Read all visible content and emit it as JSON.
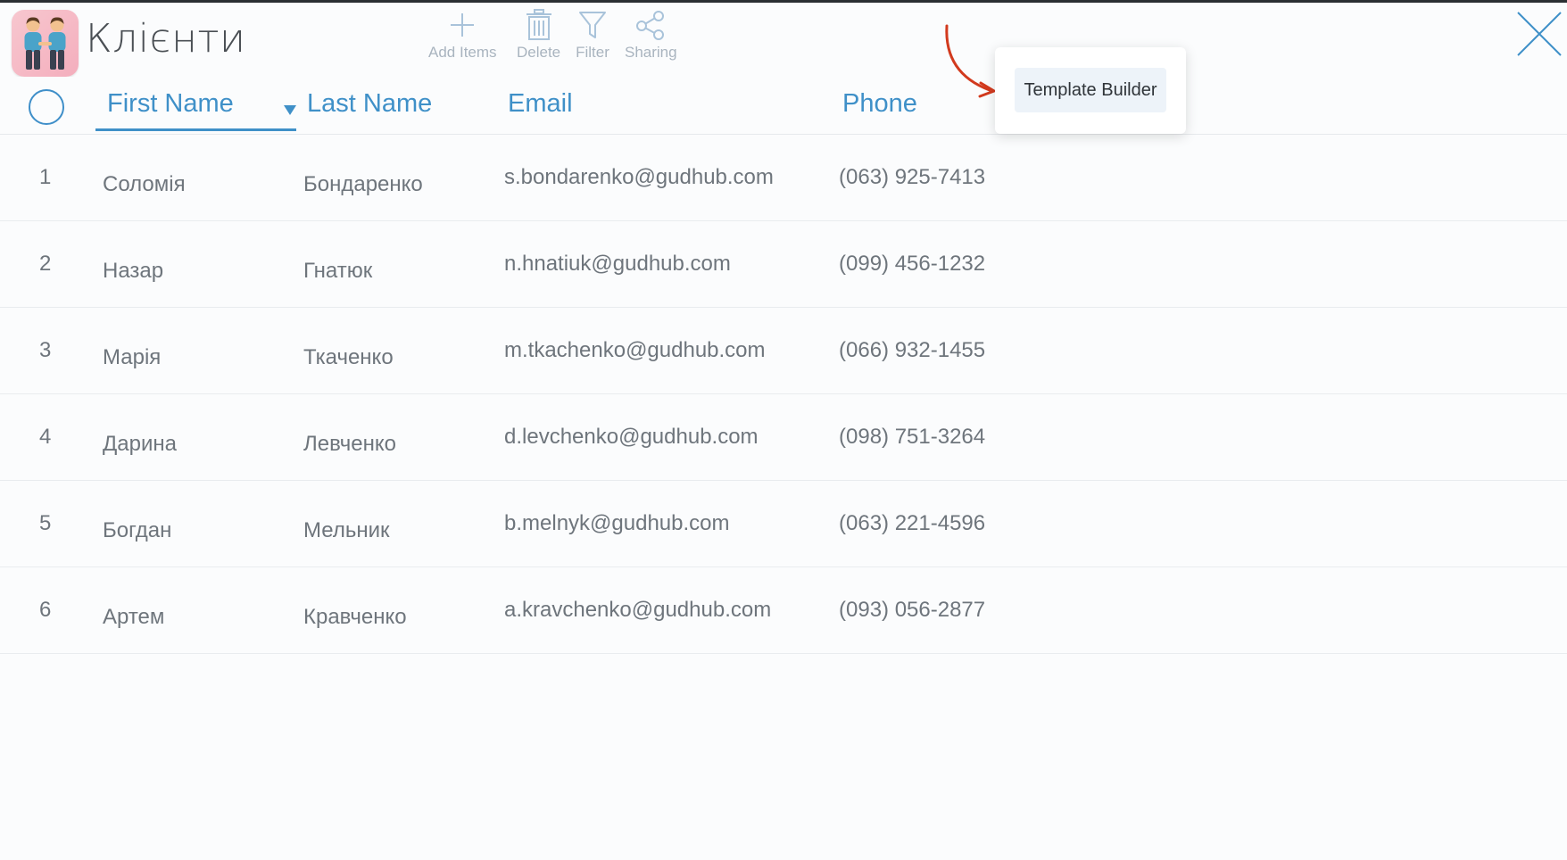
{
  "app": {
    "title": "Клієнти",
    "icon": "people-holding-hands-icon"
  },
  "toolbar": {
    "add_label": "Add Items",
    "delete_label": "Delete",
    "filter_label": "Filter",
    "sharing_label": "Sharing"
  },
  "columns": {
    "first_name": "First Name",
    "last_name": "Last Name",
    "email": "Email",
    "phone": "Phone",
    "sorted_by": "First Name"
  },
  "popover": {
    "button_label": "Template Builder"
  },
  "rows": [
    {
      "num": "1",
      "first": "Соломія",
      "last": "Бондаренко",
      "email": "s.bondarenko@gudhub.com",
      "phone": "(063) 925-7413"
    },
    {
      "num": "2",
      "first": "Назар",
      "last": "Гнатюк",
      "email": "n.hnatiuk@gudhub.com",
      "phone": "(099) 456-1232"
    },
    {
      "num": "3",
      "first": "Марія",
      "last": "Ткаченко",
      "email": "m.tkachenko@gudhub.com",
      "phone": "(066) 932-1455"
    },
    {
      "num": "4",
      "first": "Дарина",
      "last": "Левченко",
      "email": "d.levchenko@gudhub.com",
      "phone": "(098) 751-3264"
    },
    {
      "num": "5",
      "first": "Богдан",
      "last": "Мельник",
      "email": "b.melnyk@gudhub.com",
      "phone": "(063) 221-4596"
    },
    {
      "num": "6",
      "first": "Артем",
      "last": "Кравченко",
      "email": "a.kravchenko@gudhub.com",
      "phone": "(093) 056-2877"
    }
  ],
  "colors": {
    "accent": "#3f90c8",
    "annotation_arrow": "#d23a1e",
    "toolbar_icon": "#a9b4bf",
    "text": "#6e757c"
  }
}
